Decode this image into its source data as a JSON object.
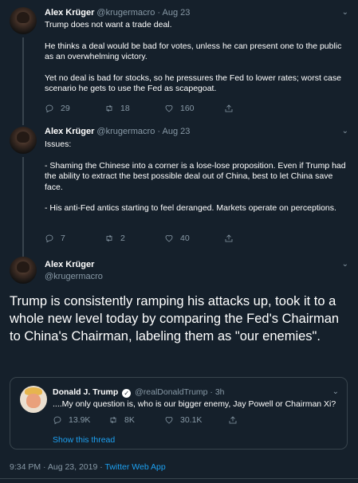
{
  "tweets": [
    {
      "name": "Alex Krüger",
      "handle": "@krugermacro",
      "date": "Aug 23",
      "paragraphs": [
        "Trump does not want a trade deal.",
        "He thinks a deal would be bad for votes, unless he can present one to the public as an overwhelming victory.",
        "Yet no deal is bad for stocks, so he pressures the Fed to lower rates; worst case scenario he gets to use the Fed as scapegoat."
      ],
      "replies": "29",
      "retweets": "18",
      "likes": "160"
    },
    {
      "name": "Alex Krüger",
      "handle": "@krugermacro",
      "date": "Aug 23",
      "paragraphs": [
        "Issues:",
        "- Shaming the Chinese into a corner is a lose-lose proposition. Even if Trump had the ability to extract the best possible deal out of China, best to let China save face.",
        "- His anti-Fed antics starting to feel deranged. Markets operate on perceptions."
      ],
      "replies": "7",
      "retweets": "2",
      "likes": "40"
    }
  ],
  "main": {
    "name": "Alex Krüger",
    "handle": "@krugermacro",
    "text": "Trump is consistently ramping his attacks up, took it to a whole new level today by comparing the Fed's Chairman to China's Chairman, labeling them as \"our enemies\".",
    "quote": {
      "name": "Donald J. Trump",
      "handle": "@realDonaldTrump",
      "time": "3h",
      "text": "....My only question is, who is our bigger enemy, Jay Powell or Chairman Xi?",
      "replies": "13.9K",
      "retweets": "8K",
      "likes": "30.1K",
      "show_thread": "Show this thread"
    },
    "timestamp": "9:34 PM · Aug 23, 2019 · ",
    "source": "Twitter Web App"
  },
  "colors": {
    "background": "#15202b",
    "secondary_text": "#8899a6",
    "link": "#1da1f2",
    "border": "#38444d"
  },
  "icons": [
    "caret-down-icon",
    "reply-icon",
    "retweet-icon",
    "like-icon",
    "share-icon",
    "verified-icon"
  ]
}
